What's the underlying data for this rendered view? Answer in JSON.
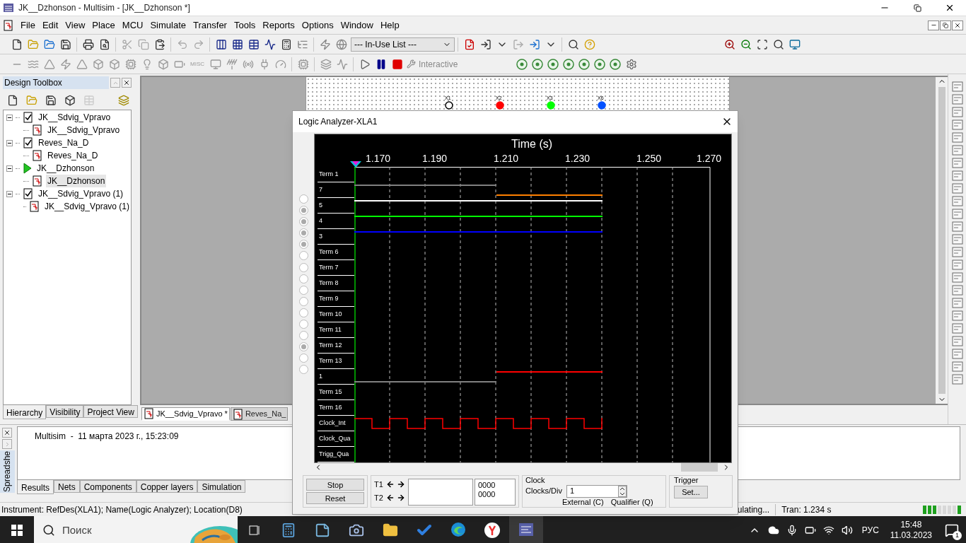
{
  "window": {
    "title": "JK__Dzhonson - Multisim - [JK__Dzhonson *]"
  },
  "menu": [
    "File",
    "Edit",
    "View",
    "Place",
    "MCU",
    "Simulate",
    "Transfer",
    "Tools",
    "Reports",
    "Options",
    "Window",
    "Help"
  ],
  "toolbar": {
    "in_use_list": "--- In-Use List ---",
    "misc_label": "MISC",
    "interactive": "Interactive"
  },
  "design_toolbox": {
    "title": "Design Toolbox",
    "tree": [
      {
        "label": "JK__Sdvig_Vpravo",
        "kind": "checked",
        "expanded": true,
        "children": [
          {
            "label": "JK__Sdvig_Vpravo",
            "selected": false
          }
        ]
      },
      {
        "label": "Reves_Na_D",
        "kind": "checked",
        "expanded": true,
        "children": [
          {
            "label": "Reves_Na_D",
            "selected": false
          }
        ]
      },
      {
        "label": "JK__Dzhonson",
        "kind": "active",
        "expanded": true,
        "children": [
          {
            "label": "JK__Dzhonson",
            "selected": true
          }
        ]
      },
      {
        "label": "JK__Sdvig_Vpravo (1)",
        "kind": "checked",
        "expanded": true,
        "children": [
          {
            "label": "JK__Sdvig_Vpravo (1)",
            "selected": false
          }
        ]
      }
    ],
    "tabs": [
      {
        "label": "Hierarchy",
        "selected": true
      },
      {
        "label": "Visibility",
        "selected": false
      },
      {
        "label": "Project View",
        "selected": false
      }
    ]
  },
  "schematic": {
    "probes": [
      {
        "label": "X1",
        "color": "#000000",
        "lit": false
      },
      {
        "label": "X2",
        "color": "#ff0000",
        "lit": true
      },
      {
        "label": "X3",
        "color": "#00ff00",
        "lit": true
      },
      {
        "label": "X6",
        "color": "#0050ff",
        "lit": true
      }
    ]
  },
  "document_tabs": [
    {
      "label": "JK__Sdvig_Vpravo *",
      "selected": true
    },
    {
      "label": "Reves_Na_",
      "selected": false
    }
  ],
  "logic_analyzer": {
    "title": "Logic Analyzer-XLA1",
    "axis_title": "Time (s)",
    "time_ticks": [
      "1.170",
      "1.190",
      "1.210",
      "1.230",
      "1.250",
      "1.270"
    ],
    "selectors": [
      {
        "selected": false
      },
      {
        "selected": true
      },
      {
        "selected": true
      },
      {
        "selected": true
      },
      {
        "selected": true
      },
      {
        "selected": false
      },
      {
        "selected": false
      },
      {
        "selected": false
      },
      {
        "selected": false
      },
      {
        "selected": false
      },
      {
        "selected": false
      },
      {
        "selected": false
      },
      {
        "selected": false
      },
      {
        "selected": true
      },
      {
        "selected": false
      },
      {
        "selected": false
      }
    ],
    "channels": [
      {
        "label": "Term 1",
        "kind": "none"
      },
      {
        "label": "7",
        "kind": "fall",
        "color": "#ff8000"
      },
      {
        "label": "5",
        "kind": "high",
        "color": "#ffffff"
      },
      {
        "label": "4",
        "kind": "high",
        "color": "#00ff00"
      },
      {
        "label": "3",
        "kind": "high",
        "color": "#0000ff"
      },
      {
        "label": "Term 6",
        "kind": "none"
      },
      {
        "label": "Term 7",
        "kind": "none"
      },
      {
        "label": "Term 8",
        "kind": "none"
      },
      {
        "label": "Term 9",
        "kind": "none"
      },
      {
        "label": "Term 10",
        "kind": "none"
      },
      {
        "label": "Term 11",
        "kind": "none"
      },
      {
        "label": "Term 12",
        "kind": "none"
      },
      {
        "label": "Term 13",
        "kind": "none"
      },
      {
        "label": "1",
        "kind": "rise",
        "color": "#ff0000"
      },
      {
        "label": "Term 15",
        "kind": "none"
      },
      {
        "label": "Term 16",
        "kind": "none"
      },
      {
        "label": "Clock_Int",
        "kind": "clock",
        "color": "#ff0000"
      },
      {
        "label": "Clock_Qua",
        "kind": "none"
      },
      {
        "label": "Trigg_Qua",
        "kind": "none"
      }
    ],
    "buttons": [
      "Stop",
      "Reset"
    ],
    "cursors": [
      "T1",
      "T2"
    ],
    "readouts": [
      "0000",
      "0000"
    ],
    "clock": {
      "title": "Clock",
      "clocks_div_label": "Clocks/Div",
      "clocks_div": "1",
      "external": "External (C)",
      "qualifier": "Qualifier (Q)"
    },
    "trigger": {
      "title": "Trigger",
      "set": "Set..."
    }
  },
  "spreadsheet": {
    "side_label": "Spreadshe",
    "log": "Multisim  -  11 марта 2023 г., 15:23:09",
    "tabs": [
      {
        "label": "Results",
        "selected": true
      },
      {
        "label": "Nets",
        "selected": false
      },
      {
        "label": "Components",
        "selected": false
      },
      {
        "label": "Copper layers",
        "selected": false
      },
      {
        "label": "Simulation",
        "selected": false
      }
    ]
  },
  "status_bar": {
    "instrument": "Instrument: RefDes(XLA1); Name(Logic Analyzer); Location(D8)",
    "simulation": "ulating...",
    "tran": "Tran: 1.234 s"
  },
  "taskbar": {
    "search": "Поиск",
    "language": "РУС",
    "time": "15:48",
    "date": "11.03.2023",
    "notifications": "1"
  }
}
